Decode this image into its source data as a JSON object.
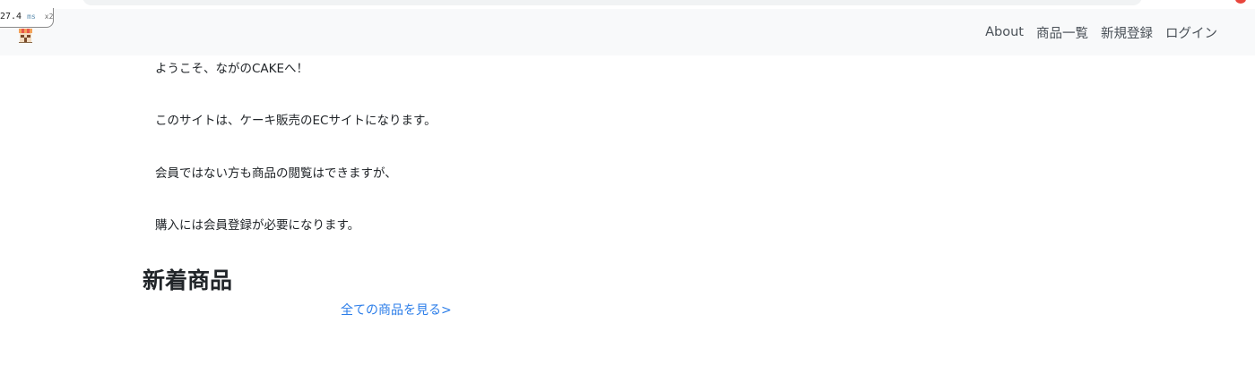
{
  "perf": {
    "value": "27.4",
    "unit": "ms",
    "multiplier": "x2"
  },
  "navbar": {
    "brand_icon": "cake-shop-icon",
    "links": [
      {
        "label": "About"
      },
      {
        "label": "商品一覧"
      },
      {
        "label": "新規登録"
      },
      {
        "label": "ログイン"
      }
    ]
  },
  "intro": {
    "lines": [
      "ようこそ、ながのCAKEへ！",
      "このサイトは、ケーキ販売のECサイトになります。",
      "会員ではない方も商品の閲覧はできますが、",
      "購入には会員登録が必要になります。"
    ]
  },
  "new_products": {
    "title": "新着商品",
    "see_all_label": "全ての商品を見る>"
  },
  "colors": {
    "navbar_bg": "#f8f9fa",
    "link": "#2b7de9",
    "text": "#212529"
  }
}
